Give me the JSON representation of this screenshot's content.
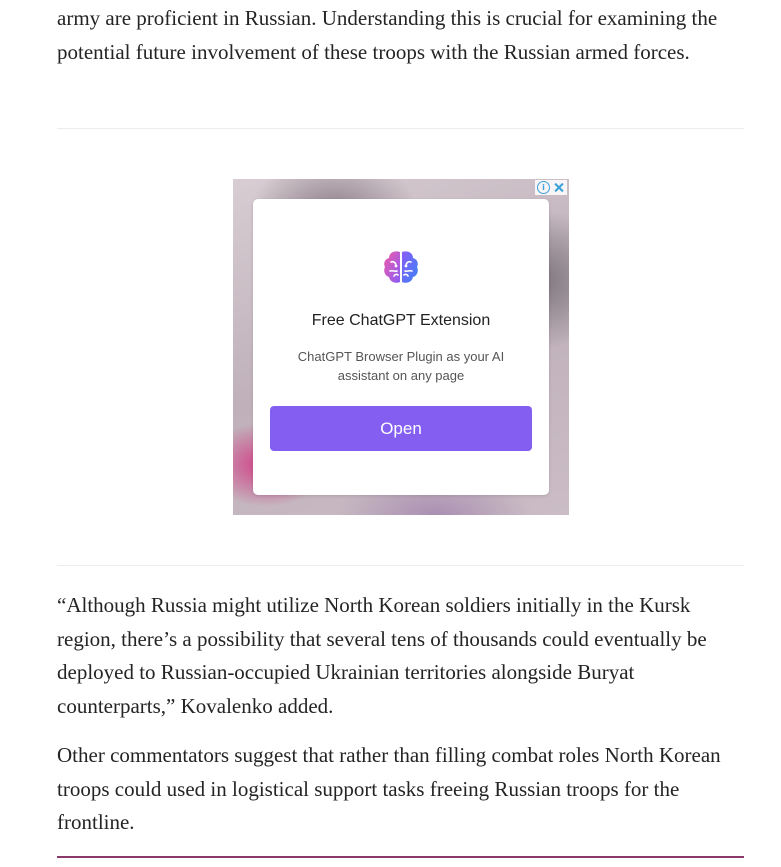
{
  "article": {
    "para_top": "army are proficient in Russian. Understanding this is crucial for examining the potential future involvement of these troops with the Russian armed forces.",
    "para_quote": "“Although Russia might utilize North Korean soldiers initially in the Kursk region, there’s a possibility that several tens of thousands could eventually be deployed to Russian-occupied Ukrainian territories alongside Buryat counterparts,” Kovalenko added.",
    "para_other": "Other commentators suggest that rather than filling combat roles North Korean troops could used in logistical support tasks freeing Russian troops for the frontline."
  },
  "ad": {
    "info_glyph": "i",
    "title": "Free ChatGPT Extension",
    "description": "ChatGPT Browser Plugin as your AI assistant on any page",
    "button_label": "Open",
    "icon": "brain-icon",
    "colors": {
      "button": "#835ef0",
      "controls": "#3aa0d8"
    }
  },
  "colors": {
    "text": "#242424",
    "divider": "#ececec",
    "accent_rule": "#8a3a6a"
  }
}
